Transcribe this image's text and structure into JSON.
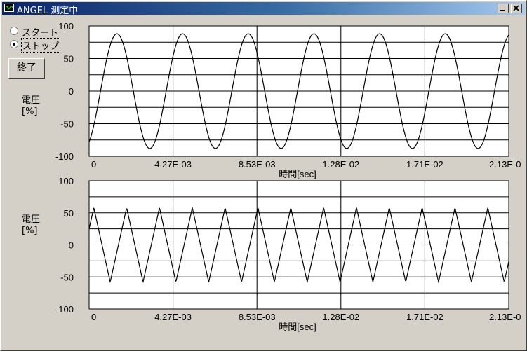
{
  "window": {
    "title": "ANGEL 測定中",
    "minimize_label": "_",
    "maximize_label": "□",
    "close_label": "×"
  },
  "controls": {
    "start_label": "スタート",
    "stop_label": "ストップ",
    "selected": "stop",
    "end_button_label": "終了"
  },
  "colors": {
    "plot_bg": "#ffffff",
    "grid": "#000000",
    "trace": "#000000",
    "face": "#d4d0c8",
    "title_start": "#0a246a",
    "title_end": "#a6caf0"
  },
  "chart_data": [
    {
      "type": "line",
      "ylabel": "電圧 [%]",
      "xlabel": "時間[sec]",
      "ylim": [
        -100,
        100
      ],
      "yticks": [
        "100",
        "50",
        "0",
        "-50",
        "-100"
      ],
      "xticks": [
        "0",
        "4.27E-03",
        "8.53E-03",
        "1.28E-02",
        "1.71E-02",
        "2.13E-0"
      ],
      "xlim": [
        0,
        0.0213
      ],
      "grid": true,
      "series": [
        {
          "waveform": "sine",
          "amplitude": 88,
          "frequency_hz": 300,
          "start_value": -78,
          "start_direction": "rising"
        }
      ]
    },
    {
      "type": "line",
      "ylabel": "電圧 [%]",
      "xlabel": "時間[sec]",
      "ylim": [
        -100,
        100
      ],
      "yticks": [
        "100",
        "50",
        "0",
        "-50",
        "-100"
      ],
      "xticks": [
        "0",
        "4.27E-03",
        "8.53E-03",
        "1.28E-02",
        "1.71E-02",
        "2.13E-0"
      ],
      "xlim": [
        0,
        0.0213
      ],
      "grid": true,
      "series": [
        {
          "waveform": "triangle",
          "amplitude": 58,
          "frequency_hz": 600,
          "start_value": 25,
          "start_direction": "rising"
        }
      ]
    }
  ]
}
